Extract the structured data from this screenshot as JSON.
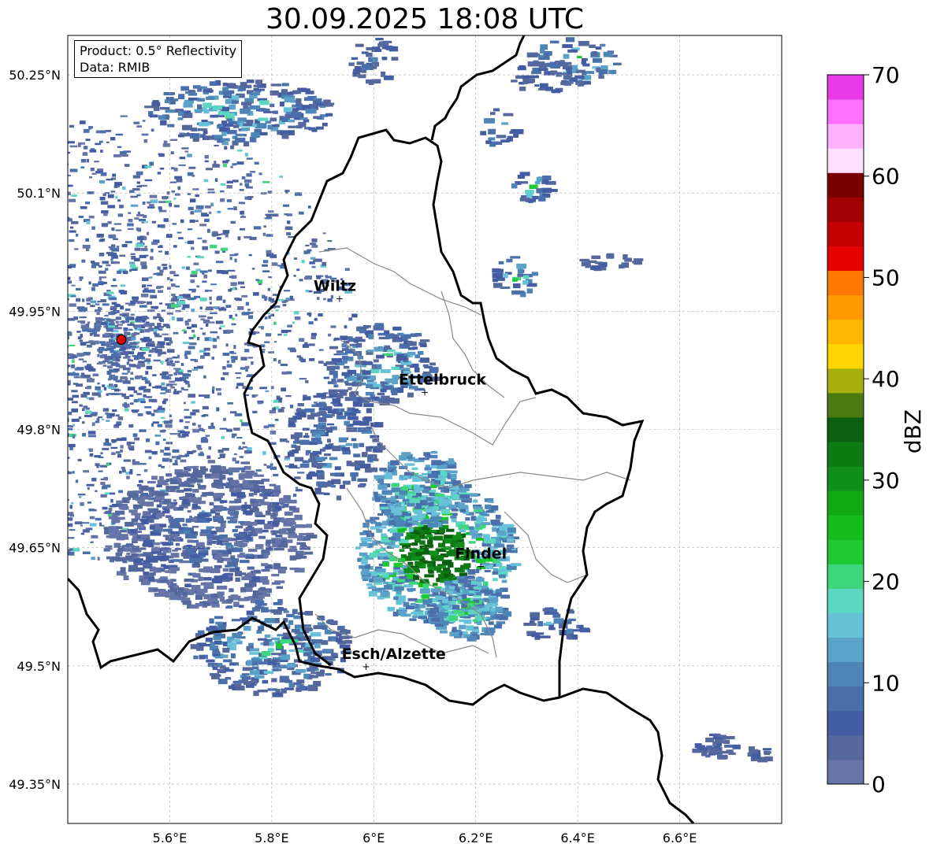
{
  "title": "30.09.2025 18:08 UTC",
  "info_box": {
    "product": "Product: 0.5° Reflectivity",
    "data": "Data: RMIB"
  },
  "map": {
    "lon_range": [
      5.4,
      6.8
    ],
    "lat_range": [
      49.3,
      50.3
    ],
    "grid": true,
    "x_ticks": [
      {
        "value": 5.6,
        "label": "5.6°E"
      },
      {
        "value": 5.8,
        "label": "5.8°E"
      },
      {
        "value": 6.0,
        "label": "6°E"
      },
      {
        "value": 6.2,
        "label": "6.2°E"
      },
      {
        "value": 6.4,
        "label": "6.4°E"
      },
      {
        "value": 6.6,
        "label": "6.6°E"
      }
    ],
    "y_ticks": [
      {
        "value": 50.25,
        "label": "50.25°N"
      },
      {
        "value": 50.1,
        "label": "50.1°N"
      },
      {
        "value": 49.95,
        "label": "49.95°N"
      },
      {
        "value": 49.8,
        "label": "49.8°N"
      },
      {
        "value": 49.65,
        "label": "49.65°N"
      },
      {
        "value": 49.5,
        "label": "49.5°N"
      },
      {
        "value": 49.35,
        "label": "49.35°N"
      }
    ],
    "radar_site": {
      "lon": 5.505,
      "lat": 49.914
    },
    "cities": [
      {
        "name": "Wiltz",
        "lon": 5.933,
        "lat": 49.967
      },
      {
        "name": "Ettelbruck",
        "lon": 6.1,
        "lat": 49.848
      },
      {
        "name": "Findel",
        "lon": 6.21,
        "lat": 49.627
      },
      {
        "name": "Esch/Alzette",
        "lon": 5.985,
        "lat": 49.5
      }
    ]
  },
  "colorbar": {
    "label": "dBZ",
    "min": 0,
    "max": 70,
    "ticks": [
      {
        "value": 0,
        "label": "0"
      },
      {
        "value": 10,
        "label": "10"
      },
      {
        "value": 20,
        "label": "20"
      },
      {
        "value": 30,
        "label": "30"
      },
      {
        "value": 40,
        "label": "40"
      },
      {
        "value": 50,
        "label": "50"
      },
      {
        "value": 60,
        "label": "60"
      },
      {
        "value": 70,
        "label": "70"
      }
    ],
    "colors": [
      "#6674a8",
      "#55689e",
      "#445da2",
      "#4a6fab",
      "#4d85b7",
      "#5aa2c8",
      "#67c2d9",
      "#5ad6c2",
      "#3ed67a",
      "#1ec830",
      "#14bc1c",
      "#12aa14",
      "#10901a",
      "#0e7a14",
      "#0a6010",
      "#4a7a10",
      "#a8b010",
      "#ffd400",
      "#ffb800",
      "#ff9a00",
      "#ff7800",
      "#e60000",
      "#c40000",
      "#a20000",
      "#7a0000",
      "#ffe0ff",
      "#ffb0ff",
      "#ff70ff",
      "#e838e8"
    ]
  }
}
